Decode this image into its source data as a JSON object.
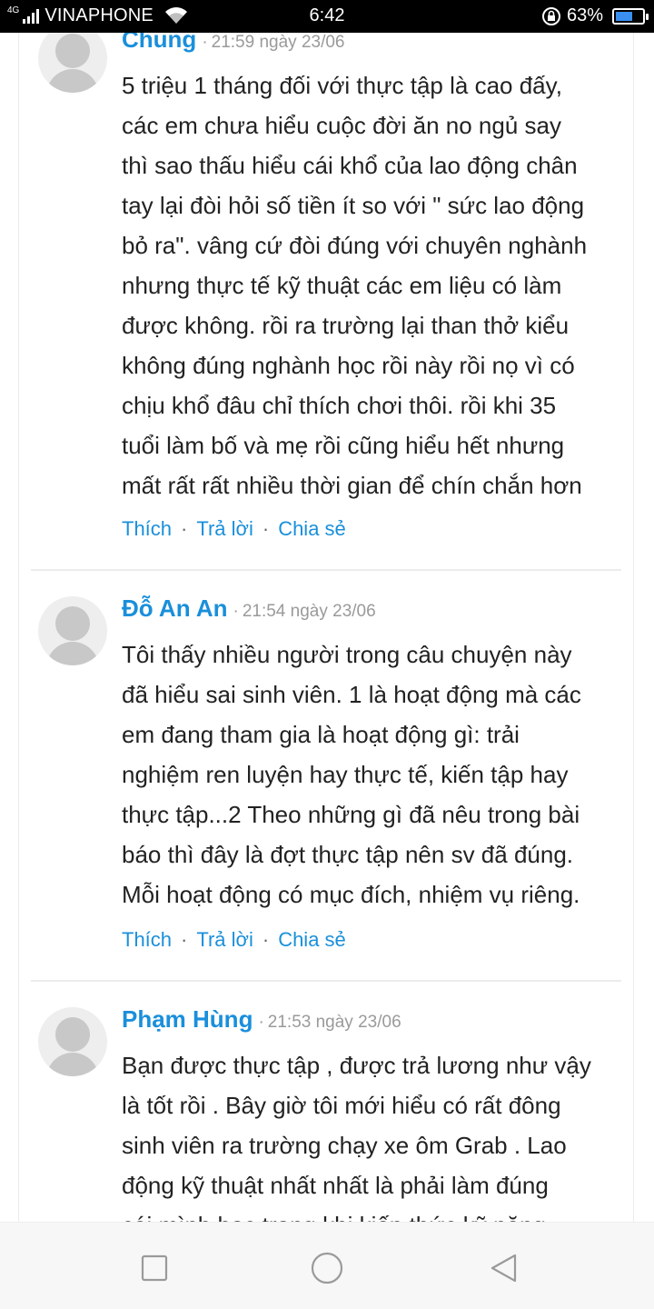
{
  "status_bar": {
    "network_type": "4G",
    "carrier": "VINAPHONE",
    "time": "6:42",
    "battery_percent": "63%",
    "battery_level": 0.63,
    "icons": [
      "signal-icon",
      "wifi-icon",
      "rotation-lock-icon",
      "battery-icon"
    ]
  },
  "comments": [
    {
      "author": "Chung",
      "time": "21:59 ngày 23/06",
      "lines": [
        "5 triệu 1 tháng đối với thực tập là cao đấy,",
        "các em chưa hiểu cuộc đời ăn no ngủ say",
        "thì sao thấu hiểu cái khổ của lao động chân",
        "tay lại đòi hỏi số tiền ít so với \" sức lao động",
        "bỏ ra\". vâng cứ đòi đúng với chuyên nghành",
        "nhưng thực tế kỹ thuật các em liệu có làm",
        "được không. rồi ra trường lại than thở kiểu",
        "không đúng nghành học rồi này rồi nọ vì có",
        "chịu khổ đâu chỉ thích chơi thôi. rồi khi 35",
        "tuổi làm bố và mẹ rồi cũng hiểu hết nhưng",
        "mất rất rất nhiều thời gian để chín chắn hơn"
      ],
      "actions": {
        "like": "Thích",
        "reply": "Trả lời",
        "share": "Chia sẻ"
      }
    },
    {
      "author": "Đỗ An An",
      "time": "21:54 ngày 23/06",
      "lines": [
        "Tôi thấy nhiều người trong câu chuyện này",
        "đã hiểu sai sinh viên. 1 là hoạt động mà các",
        "em đang tham gia là hoạt động gì: trải",
        "nghiệm ren luyện hay thực tế, kiến tập hay",
        "thực tập...2 Theo những gì đã nêu trong bài",
        "báo thì đây là đợt thực tập nên sv đã đúng.",
        "Mỗi hoạt động có mục đích, nhiệm vụ riêng."
      ],
      "actions": {
        "like": "Thích",
        "reply": "Trả lời",
        "share": "Chia sẻ"
      }
    },
    {
      "author": "Phạm Hùng",
      "time": "21:53 ngày 23/06",
      "lines": [
        "Bạn được thực tập , được trả lương như vậy",
        "là tốt rồi . Bây giờ tôi mới hiểu có rất đông",
        "sinh viên ra trường chạy xe ôm Grab . Lao",
        "động kỹ thuật nhất nhất là phải làm đúng",
        "cái mình học trong khi kiến thức kỹ năng"
      ]
    }
  ],
  "nav_bar": {
    "buttons": [
      "recent-apps-icon",
      "home-icon",
      "back-icon"
    ]
  }
}
